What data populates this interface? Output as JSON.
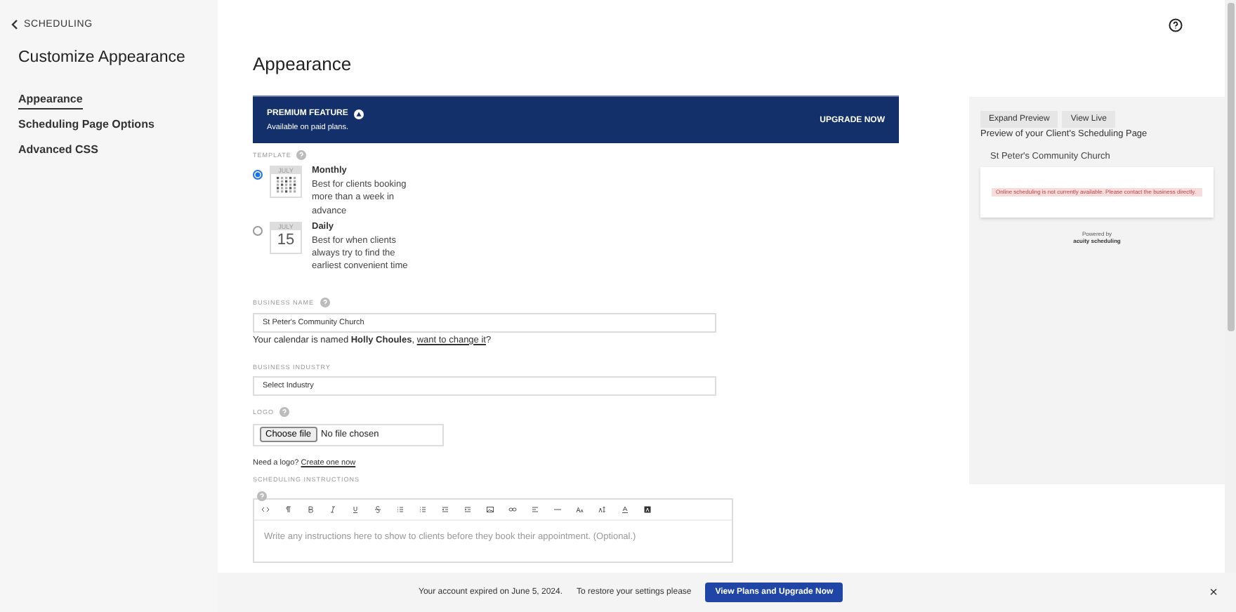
{
  "sidebar": {
    "back": "SCHEDULING",
    "title": "Customize Appearance",
    "items": [
      {
        "label": "Appearance",
        "selected": true
      },
      {
        "label": "Scheduling Page Options",
        "selected": false
      },
      {
        "label": "Advanced CSS",
        "selected": false
      }
    ]
  },
  "main": {
    "title": "Appearance",
    "premium": {
      "title": "PREMIUM FEATURE",
      "subtitle": "Available on paid plans.",
      "action": "UPGRADE NOW"
    },
    "template": {
      "label": "TEMPLATE",
      "options": [
        {
          "kind": "monthly",
          "month": "JULY",
          "name": "Monthly",
          "description": "Best for clients booking more than a week in advance",
          "selected": true
        },
        {
          "kind": "daily",
          "month": "JULY",
          "day": "15",
          "name": "Daily",
          "description": "Best for when clients always try to find the earliest convenient time",
          "selected": false
        }
      ]
    },
    "business_name": {
      "label": "BUSINESS NAME",
      "value": "St Peter's Community Church",
      "note": "Your calendar is named **Holly Choules**, ",
      "link": "want to change it",
      "note_end": "?"
    },
    "business_industry": {
      "label": "BUSINESS INDUSTRY",
      "value": "Select Industry"
    },
    "logo": {
      "label": "LOGO",
      "button": "Choose file",
      "status": "No file chosen",
      "note": "Need a logo?",
      "link": "Create one now"
    },
    "instructions": {
      "label": "SCHEDULING INSTRUCTIONS",
      "placeholder": "Write any instructions here to show to clients before they book their appointment. (Optional.)"
    }
  },
  "preview": {
    "buttons": [
      "Expand Preview",
      "View Live"
    ],
    "heading": "Preview of your Client's Scheduling Page",
    "business": "St Peter's Community Church",
    "alert": "Online scheduling is not currently available. Please contact the business directly.",
    "powered_by": "Powered by",
    "brand": "acuity scheduling"
  },
  "banner": {
    "message": "Your account expired on June 5, 2024.",
    "prompt": "To restore your settings please",
    "button": "View Plans and Upgrade Now",
    "close": "×"
  }
}
